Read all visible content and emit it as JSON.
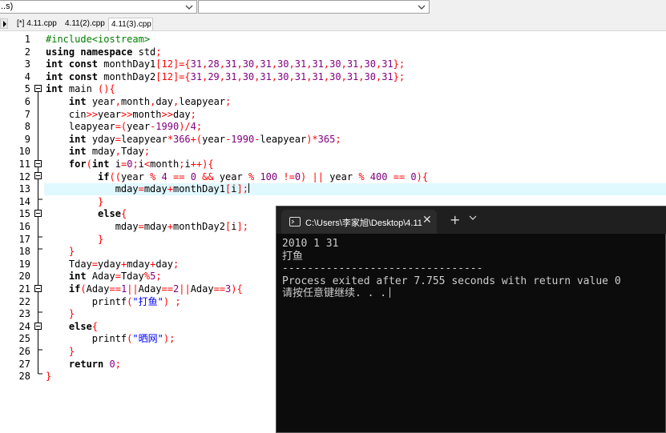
{
  "toolbar": {
    "combo1_value": "..s)",
    "combo2_value": ""
  },
  "tabs": [
    {
      "label": "[*] 4.11.cpp"
    },
    {
      "label": "4.11(2).cpp"
    },
    {
      "label": "4.11(3).cpp"
    }
  ],
  "editor": {
    "current_line": 13,
    "line_numbers": [
      "1",
      "2",
      "3",
      "4",
      "5",
      "6",
      "7",
      "8",
      "9",
      "10",
      "11",
      "12",
      "13",
      "14",
      "15",
      "16",
      "17",
      "18",
      "19",
      "20",
      "21",
      "22",
      "23",
      "24",
      "25",
      "26",
      "27",
      "28"
    ],
    "lines": [
      [
        [
          "pp",
          "#include<iostream>"
        ]
      ],
      [
        [
          "k",
          "using namespace"
        ],
        [
          "d",
          " std"
        ],
        [
          "o",
          ";"
        ]
      ],
      [
        [
          "k",
          "int const"
        ],
        [
          "d",
          " monthDay1"
        ],
        [
          "o",
          "[12]={"
        ],
        [
          "n",
          "31"
        ],
        [
          "o",
          ","
        ],
        [
          "n",
          "28"
        ],
        [
          "o",
          ","
        ],
        [
          "n",
          "31"
        ],
        [
          "o",
          ","
        ],
        [
          "n",
          "30"
        ],
        [
          "o",
          ","
        ],
        [
          "n",
          "31"
        ],
        [
          "o",
          ","
        ],
        [
          "n",
          "30"
        ],
        [
          "o",
          ","
        ],
        [
          "n",
          "31"
        ],
        [
          "o",
          ","
        ],
        [
          "n",
          "31"
        ],
        [
          "o",
          ","
        ],
        [
          "n",
          "30"
        ],
        [
          "o",
          ","
        ],
        [
          "n",
          "31"
        ],
        [
          "o",
          ","
        ],
        [
          "n",
          "30"
        ],
        [
          "o",
          ","
        ],
        [
          "n",
          "31"
        ],
        [
          "o",
          "};"
        ]
      ],
      [
        [
          "k",
          "int const"
        ],
        [
          "d",
          " monthDay2"
        ],
        [
          "o",
          "[12]={"
        ],
        [
          "n",
          "31"
        ],
        [
          "o",
          ","
        ],
        [
          "n",
          "29"
        ],
        [
          "o",
          ","
        ],
        [
          "n",
          "31"
        ],
        [
          "o",
          ","
        ],
        [
          "n",
          "30"
        ],
        [
          "o",
          ","
        ],
        [
          "n",
          "31"
        ],
        [
          "o",
          ","
        ],
        [
          "n",
          "30"
        ],
        [
          "o",
          ","
        ],
        [
          "n",
          "31"
        ],
        [
          "o",
          ","
        ],
        [
          "n",
          "31"
        ],
        [
          "o",
          ","
        ],
        [
          "n",
          "30"
        ],
        [
          "o",
          ","
        ],
        [
          "n",
          "31"
        ],
        [
          "o",
          ","
        ],
        [
          "n",
          "30"
        ],
        [
          "o",
          ","
        ],
        [
          "n",
          "31"
        ],
        [
          "o",
          "};"
        ]
      ],
      [
        [
          "k",
          "int"
        ],
        [
          "d",
          " main "
        ],
        [
          "o",
          "(){"
        ]
      ],
      [
        [
          "d",
          "    "
        ],
        [
          "k",
          "int"
        ],
        [
          "d",
          " year"
        ],
        [
          "o",
          ","
        ],
        [
          "d",
          "month"
        ],
        [
          "o",
          ","
        ],
        [
          "d",
          "day"
        ],
        [
          "o",
          ","
        ],
        [
          "d",
          "leapyear"
        ],
        [
          "o",
          ";"
        ]
      ],
      [
        [
          "d",
          "    cin"
        ],
        [
          "o",
          ">>"
        ],
        [
          "d",
          "year"
        ],
        [
          "o",
          ">>"
        ],
        [
          "d",
          "month"
        ],
        [
          "o",
          ">>"
        ],
        [
          "d",
          "day"
        ],
        [
          "o",
          ";"
        ]
      ],
      [
        [
          "d",
          "    leapyear"
        ],
        [
          "o",
          "=("
        ],
        [
          "d",
          "year"
        ],
        [
          "o",
          "-"
        ],
        [
          "n",
          "1990"
        ],
        [
          "o",
          ")/"
        ],
        [
          "n",
          "4"
        ],
        [
          "o",
          ";"
        ]
      ],
      [
        [
          "d",
          "    "
        ],
        [
          "k",
          "int"
        ],
        [
          "d",
          " yday"
        ],
        [
          "o",
          "="
        ],
        [
          "d",
          "leapyear"
        ],
        [
          "o",
          "*"
        ],
        [
          "n",
          "366"
        ],
        [
          "o",
          "+("
        ],
        [
          "d",
          "year"
        ],
        [
          "o",
          "-"
        ],
        [
          "n",
          "1990"
        ],
        [
          "o",
          "-"
        ],
        [
          "d",
          "leapyear"
        ],
        [
          "o",
          ")*"
        ],
        [
          "n",
          "365"
        ],
        [
          "o",
          ";"
        ]
      ],
      [
        [
          "d",
          "    "
        ],
        [
          "k",
          "int"
        ],
        [
          "d",
          " mday"
        ],
        [
          "o",
          ","
        ],
        [
          "d",
          "Tday"
        ],
        [
          "o",
          ";"
        ]
      ],
      [
        [
          "d",
          "    "
        ],
        [
          "k",
          "for"
        ],
        [
          "o",
          "("
        ],
        [
          "k",
          "int"
        ],
        [
          "d",
          " i"
        ],
        [
          "o",
          "="
        ],
        [
          "n",
          "0"
        ],
        [
          "o",
          ";"
        ],
        [
          "d",
          "i"
        ],
        [
          "o",
          "<"
        ],
        [
          "d",
          "month"
        ],
        [
          "o",
          ";"
        ],
        [
          "d",
          "i"
        ],
        [
          "o",
          "++){"
        ]
      ],
      [
        [
          "d",
          "         "
        ],
        [
          "k",
          "if"
        ],
        [
          "o",
          "(("
        ],
        [
          "d",
          "year "
        ],
        [
          "o",
          "%"
        ],
        [
          "d",
          " "
        ],
        [
          "n",
          "4"
        ],
        [
          "d",
          " "
        ],
        [
          "o",
          "=="
        ],
        [
          "d",
          " "
        ],
        [
          "n",
          "0"
        ],
        [
          "d",
          " "
        ],
        [
          "o",
          "&&"
        ],
        [
          "d",
          " year "
        ],
        [
          "o",
          "%"
        ],
        [
          "d",
          " "
        ],
        [
          "n",
          "100"
        ],
        [
          "d",
          " "
        ],
        [
          "o",
          "!="
        ],
        [
          "n",
          "0"
        ],
        [
          "o",
          ")"
        ],
        [
          "d",
          " "
        ],
        [
          "o",
          "||"
        ],
        [
          "d",
          " year "
        ],
        [
          "o",
          "%"
        ],
        [
          "d",
          " "
        ],
        [
          "n",
          "400"
        ],
        [
          "d",
          " "
        ],
        [
          "o",
          "=="
        ],
        [
          "d",
          " "
        ],
        [
          "n",
          "0"
        ],
        [
          "o",
          "){"
        ]
      ],
      [
        [
          "d",
          "            mday"
        ],
        [
          "o",
          "="
        ],
        [
          "d",
          "mday"
        ],
        [
          "o",
          "+"
        ],
        [
          "d",
          "monthDay1"
        ],
        [
          "o",
          "["
        ],
        [
          "d",
          "i"
        ],
        [
          "o",
          "];"
        ]
      ],
      [
        [
          "d",
          "         "
        ],
        [
          "o",
          "}"
        ]
      ],
      [
        [
          "d",
          "         "
        ],
        [
          "k",
          "else"
        ],
        [
          "o",
          "{"
        ]
      ],
      [
        [
          "d",
          "            mday"
        ],
        [
          "o",
          "="
        ],
        [
          "d",
          "mday"
        ],
        [
          "o",
          "+"
        ],
        [
          "d",
          "monthDay2"
        ],
        [
          "o",
          "["
        ],
        [
          "d",
          "i"
        ],
        [
          "o",
          "];"
        ]
      ],
      [
        [
          "d",
          "         "
        ],
        [
          "o",
          "}"
        ]
      ],
      [
        [
          "d",
          "    "
        ],
        [
          "o",
          "}"
        ]
      ],
      [
        [
          "d",
          "    Tday"
        ],
        [
          "o",
          "="
        ],
        [
          "d",
          "yday"
        ],
        [
          "o",
          "+"
        ],
        [
          "d",
          "mday"
        ],
        [
          "o",
          "+"
        ],
        [
          "d",
          "day"
        ],
        [
          "o",
          ";"
        ]
      ],
      [
        [
          "d",
          "    "
        ],
        [
          "k",
          "int"
        ],
        [
          "d",
          " Aday"
        ],
        [
          "o",
          "="
        ],
        [
          "d",
          "Tday"
        ],
        [
          "o",
          "%"
        ],
        [
          "n",
          "5"
        ],
        [
          "o",
          ";"
        ]
      ],
      [
        [
          "d",
          "    "
        ],
        [
          "k",
          "if"
        ],
        [
          "o",
          "("
        ],
        [
          "d",
          "Aday"
        ],
        [
          "o",
          "=="
        ],
        [
          "n",
          "1"
        ],
        [
          "o",
          "||"
        ],
        [
          "d",
          "Aday"
        ],
        [
          "o",
          "=="
        ],
        [
          "n",
          "2"
        ],
        [
          "o",
          "||"
        ],
        [
          "d",
          "Aday"
        ],
        [
          "o",
          "=="
        ],
        [
          "n",
          "3"
        ],
        [
          "o",
          "){"
        ]
      ],
      [
        [
          "d",
          "        printf"
        ],
        [
          "o",
          "("
        ],
        [
          "s",
          "\"打鱼\""
        ],
        [
          "o",
          ")"
        ],
        [
          "d",
          " "
        ],
        [
          "o",
          ";"
        ]
      ],
      [
        [
          "d",
          "    "
        ],
        [
          "o",
          "}"
        ]
      ],
      [
        [
          "d",
          "    "
        ],
        [
          "k",
          "else"
        ],
        [
          "o",
          "{"
        ]
      ],
      [
        [
          "d",
          "        printf"
        ],
        [
          "o",
          "("
        ],
        [
          "s",
          "\"晒网\""
        ],
        [
          "o",
          ");"
        ]
      ],
      [
        [
          "d",
          "    "
        ],
        [
          "o",
          "}"
        ]
      ],
      [
        [
          "d",
          "    "
        ],
        [
          "k",
          "return"
        ],
        [
          "d",
          " "
        ],
        [
          "n",
          "0"
        ],
        [
          "o",
          ";"
        ]
      ],
      [
        [
          "o",
          "}"
        ]
      ]
    ]
  },
  "terminal": {
    "tab_title": "C:\\Users\\李家旭\\Desktop\\4.11",
    "close_glyph": "✕",
    "new_tab_glyph": "+",
    "lines": [
      "2010 1 31",
      "打鱼",
      "--------------------------------",
      "Process exited after 7.755 seconds with return value 0",
      "请按任意键继续. . ."
    ]
  },
  "colors": {
    "keyword": "#000000",
    "operator": "#ff0000",
    "number": "#800080",
    "string": "#0000ff",
    "preprocessor": "#008000",
    "current_line": "#e0f8ff",
    "terminal_bg": "#0c0c0c",
    "terminal_text": "#cccccc"
  }
}
